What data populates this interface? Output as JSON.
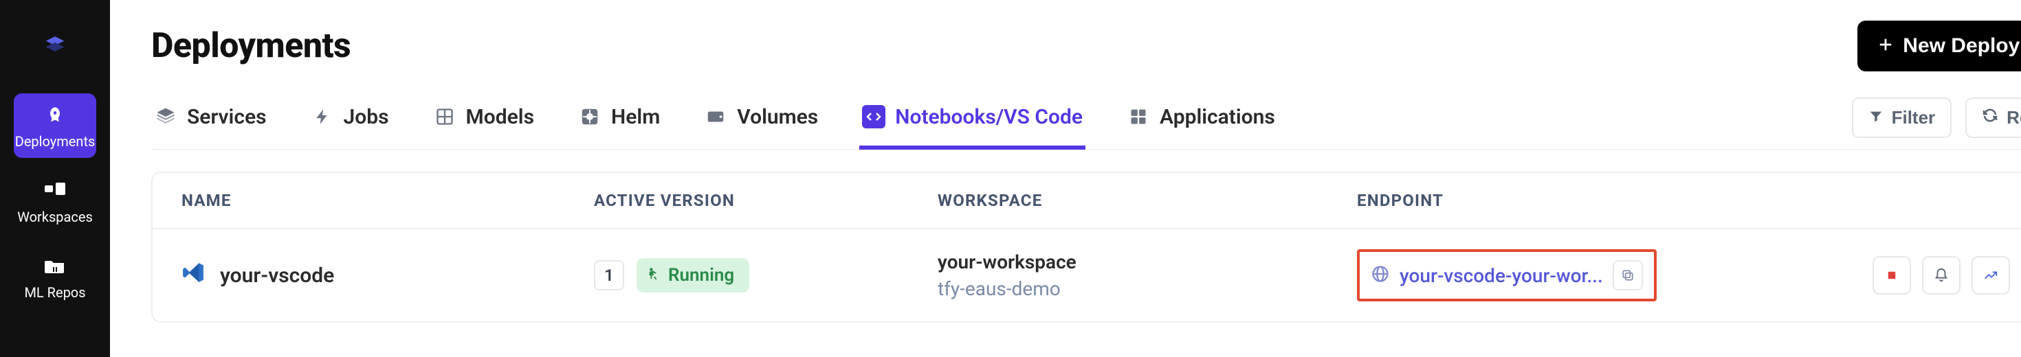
{
  "sidebar": {
    "items": [
      {
        "label": "Deployments"
      },
      {
        "label": "Workspaces"
      },
      {
        "label": "ML Repos"
      }
    ]
  },
  "header": {
    "title": "Deployments",
    "new_button": "New Deployment"
  },
  "tabs": [
    {
      "label": "Services"
    },
    {
      "label": "Jobs"
    },
    {
      "label": "Models"
    },
    {
      "label": "Helm"
    },
    {
      "label": "Volumes"
    },
    {
      "label": "Notebooks/VS Code"
    },
    {
      "label": "Applications"
    }
  ],
  "controls": {
    "filter": "Filter",
    "refresh": "Refresh"
  },
  "table": {
    "columns": {
      "name": "NAME",
      "active_version": "ACTIVE VERSION",
      "workspace": "WORKSPACE",
      "endpoint": "ENDPOINT"
    },
    "rows": [
      {
        "name": "your-vscode",
        "version": "1",
        "status": "Running",
        "workspace": "your-workspace",
        "workspace_sub": "tfy-eaus-demo",
        "endpoint": "your-vscode-your-wor..."
      }
    ]
  }
}
